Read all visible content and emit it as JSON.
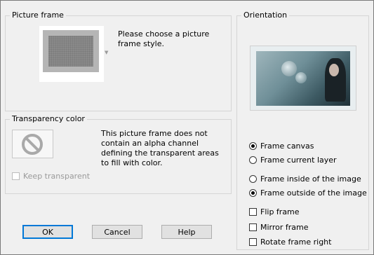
{
  "picture_frame": {
    "group_title": "Picture frame",
    "description": "Please choose a picture frame style."
  },
  "transparency": {
    "group_title": "Transparency color",
    "description": "This picture frame does not contain an alpha channel defining the transparent areas to fill with color.",
    "keep_transparent_label": "Keep transparent",
    "keep_transparent_checked": false
  },
  "orientation": {
    "group_title": "Orientation",
    "frame_canvas_label": "Frame canvas",
    "frame_current_layer_label": "Frame current layer",
    "frame_inside_label": "Frame inside of the image",
    "frame_outside_label": "Frame outside of the image",
    "selected_target": "Frame canvas",
    "selected_position": "Frame outside of the image"
  },
  "options": {
    "flip_frame_label": "Flip frame",
    "mirror_frame_label": "Mirror frame",
    "rotate_frame_right_label": "Rotate frame right"
  },
  "buttons": {
    "ok": "OK",
    "cancel": "Cancel",
    "help": "Help"
  },
  "colors": {
    "default_button_border": "#0078d7",
    "window_bg": "#f0f0f0"
  }
}
